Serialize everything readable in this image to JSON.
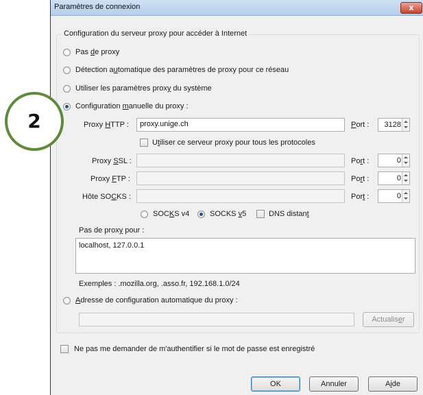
{
  "window": {
    "title": "Paramètres de connexion",
    "close_symbol": "x"
  },
  "group": {
    "legend": "Configuration du serveur proxy pour accéder à Internet"
  },
  "options": {
    "no_proxy": {
      "pre": "Pas ",
      "key": "d",
      "post": "e proxy",
      "checked": false
    },
    "auto_detect": {
      "pre": "Détection a",
      "key": "u",
      "post": "tomatique des paramètres de proxy pour ce réseau",
      "checked": false
    },
    "system": {
      "pre": "Utiliser les paramètres prox",
      "key": "y",
      "post": " du système",
      "checked": false
    },
    "manual": {
      "pre": "Configuration ",
      "key": "m",
      "post": "anuelle du proxy :",
      "checked": true
    },
    "auto_url": {
      "pre": "",
      "key": "A",
      "post": "dresse de configuration automatique du proxy :",
      "checked": false
    }
  },
  "http": {
    "label_pre": "Proxy ",
    "label_key": "H",
    "label_post": "TTP :",
    "value": "proxy.unige.ch",
    "port_label_key": "P",
    "port_label_post": "ort :",
    "port": "3128"
  },
  "same_proxy": {
    "pre": "U",
    "key": "t",
    "post": "iliser ce serveur proxy pour tous les protocoles"
  },
  "ssl": {
    "label_pre": "Proxy ",
    "label_key": "S",
    "label_post": "SL :",
    "value": "",
    "port_label_pre": "Po",
    "port_label_key": "r",
    "port_label_post": "t :",
    "port": "0"
  },
  "ftp": {
    "label_pre": "Proxy ",
    "label_key": "F",
    "label_post": "TP :",
    "value": "",
    "port_label_pre": "Po",
    "port_label_key": "r",
    "port_label_post": "t :",
    "port": "0"
  },
  "socks": {
    "label_pre": "Hôte SO",
    "label_key": "C",
    "label_post": "KS :",
    "value": "",
    "port_label_pre": "Por",
    "port_label_key": "t",
    "port_label_post": " :",
    "port": "0"
  },
  "socks_opts": {
    "v4": {
      "pre": "SOC",
      "key": "K",
      "post": "S v4",
      "checked": false
    },
    "v5": {
      "pre": "SOCKS ",
      "key": "v",
      "post": "5",
      "checked": true
    },
    "dns": {
      "pre": "DNS distan",
      "key": "t",
      "post": ""
    }
  },
  "no_proxy_for": {
    "label_pre": "Pas de prox",
    "label_key": "y",
    "label_post": " pour :",
    "value": "localhost, 127.0.0.1"
  },
  "examples": "Exemples : .mozilla.org, .asso.fr, 192.168.1.0/24",
  "auto_url_field": {
    "value": ""
  },
  "refresh_button": {
    "pre": "Actualis",
    "key": "e",
    "post": "r"
  },
  "no_auth_prompt": {
    "pre": "Ne pas me demander de m'authentifier si le mot de passe est enre",
    "key": "g",
    "post": "istré"
  },
  "buttons": {
    "ok": "OK",
    "cancel": "Annuler",
    "help_pre": "A",
    "help_key": "i",
    "help_post": "de"
  },
  "annotation": {
    "number": "2",
    "color": "#5f8a3a"
  }
}
